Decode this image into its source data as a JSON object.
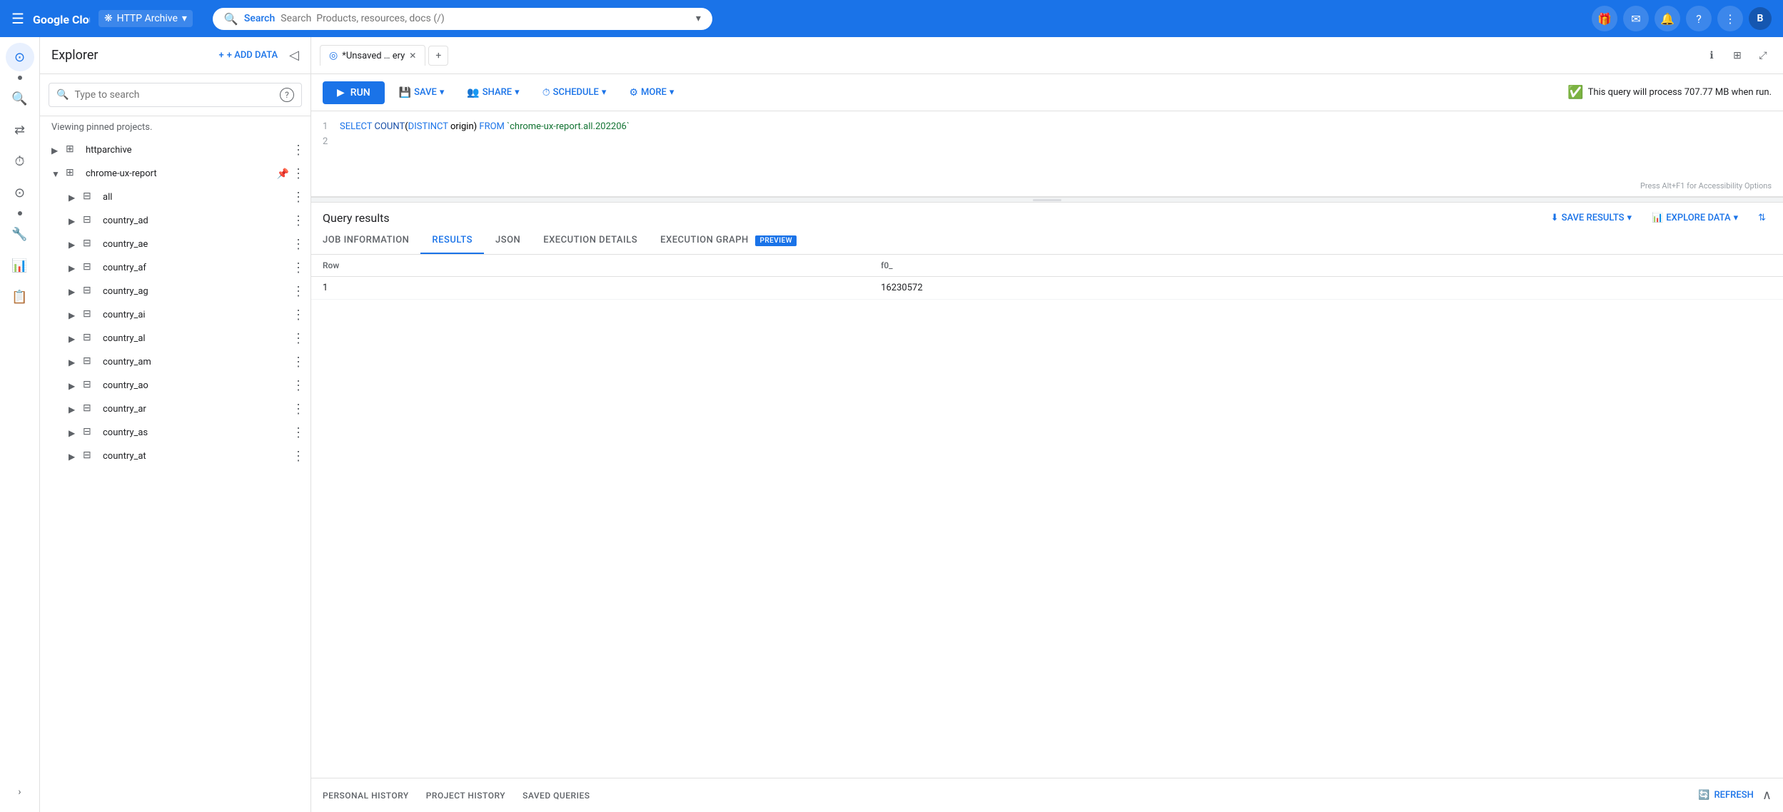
{
  "topnav": {
    "menu_icon": "☰",
    "logo_text": "Google Cloud",
    "project": "HTTP Archive",
    "search_placeholder": "Search  Products, resources, docs (/)",
    "nav_icons": [
      "🎁",
      "✉",
      "🔔",
      "?",
      "⋮"
    ],
    "avatar": "B"
  },
  "icon_sidebar": {
    "items": [
      {
        "icon": "⊙",
        "name": "analytics-icon",
        "active": true
      },
      {
        "icon": "⇄",
        "name": "transfer-icon"
      },
      {
        "icon": "⊙",
        "name": "history-icon"
      },
      {
        "icon": "⚙",
        "name": "schedule-icon"
      },
      {
        "icon": "🔧",
        "name": "tools-icon"
      },
      {
        "icon": "📊",
        "name": "chart-icon"
      },
      {
        "icon": "📋",
        "name": "reports-icon"
      }
    ],
    "expand_icon": "›"
  },
  "explorer": {
    "title": "Explorer",
    "add_data_label": "+ ADD DATA",
    "collapse_icon": "◁",
    "search_placeholder": "Type to search",
    "pinned_label": "Viewing pinned projects.",
    "tree": [
      {
        "level": 0,
        "name": "httparchive",
        "expanded": false,
        "pinned": false,
        "has_more": true
      },
      {
        "level": 0,
        "name": "chrome-ux-report",
        "expanded": true,
        "pinned": true,
        "has_more": true
      },
      {
        "level": 1,
        "name": "all",
        "expanded": false,
        "pinned": false,
        "has_more": true
      },
      {
        "level": 1,
        "name": "country_ad",
        "expanded": false,
        "pinned": false,
        "has_more": true
      },
      {
        "level": 1,
        "name": "country_ae",
        "expanded": false,
        "pinned": false,
        "has_more": true
      },
      {
        "level": 1,
        "name": "country_af",
        "expanded": false,
        "pinned": false,
        "has_more": true
      },
      {
        "level": 1,
        "name": "country_ag",
        "expanded": false,
        "pinned": false,
        "has_more": true
      },
      {
        "level": 1,
        "name": "country_ai",
        "expanded": false,
        "pinned": false,
        "has_more": true
      },
      {
        "level": 1,
        "name": "country_al",
        "expanded": false,
        "pinned": false,
        "has_more": true
      },
      {
        "level": 1,
        "name": "country_am",
        "expanded": false,
        "pinned": false,
        "has_more": true
      },
      {
        "level": 1,
        "name": "country_ao",
        "expanded": false,
        "pinned": false,
        "has_more": true
      },
      {
        "level": 1,
        "name": "country_ar",
        "expanded": false,
        "pinned": false,
        "has_more": true
      },
      {
        "level": 1,
        "name": "country_as",
        "expanded": false,
        "pinned": false,
        "has_more": true
      },
      {
        "level": 1,
        "name": "country_at",
        "expanded": false,
        "pinned": false,
        "has_more": true
      }
    ]
  },
  "tabs_bar": {
    "tabs": [
      {
        "label": "*Unsaved … ery",
        "icon": "◎",
        "closable": true
      }
    ],
    "new_tab_icon": "+",
    "action_icons": [
      "ℹ",
      "⊞",
      "⤢"
    ]
  },
  "toolbar": {
    "run_label": "RUN",
    "save_label": "SAVE",
    "share_label": "SHARE",
    "schedule_label": "SCHEDULE",
    "more_label": "MORE",
    "query_info": "This query will process 707.77 MB when run."
  },
  "editor": {
    "lines": [
      {
        "num": "1",
        "content": "SELECT COUNT(DISTINCT origin) FROM `chrome-ux-report.all.202206`"
      },
      {
        "num": "2",
        "content": ""
      }
    ],
    "accessibility_hint": "Press Alt+F1 for Accessibility Options"
  },
  "results": {
    "title": "Query results",
    "save_results_label": "SAVE RESULTS",
    "explore_data_label": "EXPLORE DATA",
    "tabs": [
      {
        "label": "JOB INFORMATION",
        "active": false
      },
      {
        "label": "RESULTS",
        "active": true
      },
      {
        "label": "JSON",
        "active": false
      },
      {
        "label": "EXECUTION DETAILS",
        "active": false
      },
      {
        "label": "EXECUTION GRAPH",
        "active": false,
        "badge": "PREVIEW"
      }
    ],
    "table": {
      "columns": [
        "Row",
        "f0_"
      ],
      "rows": [
        [
          "1",
          "16230572"
        ]
      ]
    }
  },
  "bottom_bar": {
    "tabs": [
      "PERSONAL HISTORY",
      "PROJECT HISTORY",
      "SAVED QUERIES"
    ],
    "refresh_label": "REFRESH",
    "collapse_icon": "∧"
  }
}
